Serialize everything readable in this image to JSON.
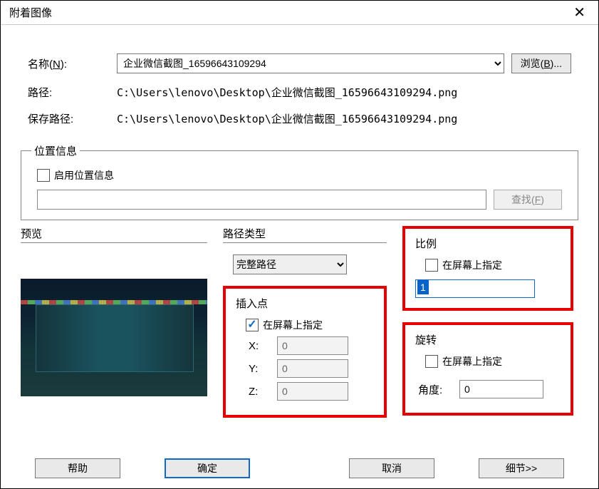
{
  "title": "附着图像",
  "top": {
    "name_label_pre": "名称(",
    "name_label_u": "N",
    "name_label_post": "):",
    "name_select_value": "企业微信截图_16596643109294",
    "browse_pre": "浏览(",
    "browse_u": "B",
    "browse_post": ")...",
    "path_label": "路径:",
    "path_value": "C:\\Users\\lenovo\\Desktop\\企业微信截图_16596643109294.png",
    "savepath_label": "保存路径:",
    "savepath_value": "C:\\Users\\lenovo\\Desktop\\企业微信截图_16596643109294.png"
  },
  "location": {
    "legend": "位置信息",
    "enable_label": "启用位置信息",
    "find_pre": "查找(",
    "find_u": "F",
    "find_post": ")"
  },
  "preview_hdr": "预览",
  "pathtype": {
    "hdr": "路径类型",
    "value": "完整路径"
  },
  "insert": {
    "hdr": "插入点",
    "onscreen": "在屏幕上指定",
    "x_label": "X:",
    "y_label": "Y:",
    "z_label": "Z:",
    "x": "0",
    "y": "0",
    "z": "0"
  },
  "scale": {
    "hdr": "比例",
    "onscreen": "在屏幕上指定",
    "value": "1"
  },
  "rotate": {
    "hdr": "旋转",
    "onscreen": "在屏幕上指定",
    "angle_label": "角度:",
    "angle": "0"
  },
  "footer": {
    "help": "帮助",
    "ok": "确定",
    "cancel": "取消",
    "detail": "细节>>"
  }
}
